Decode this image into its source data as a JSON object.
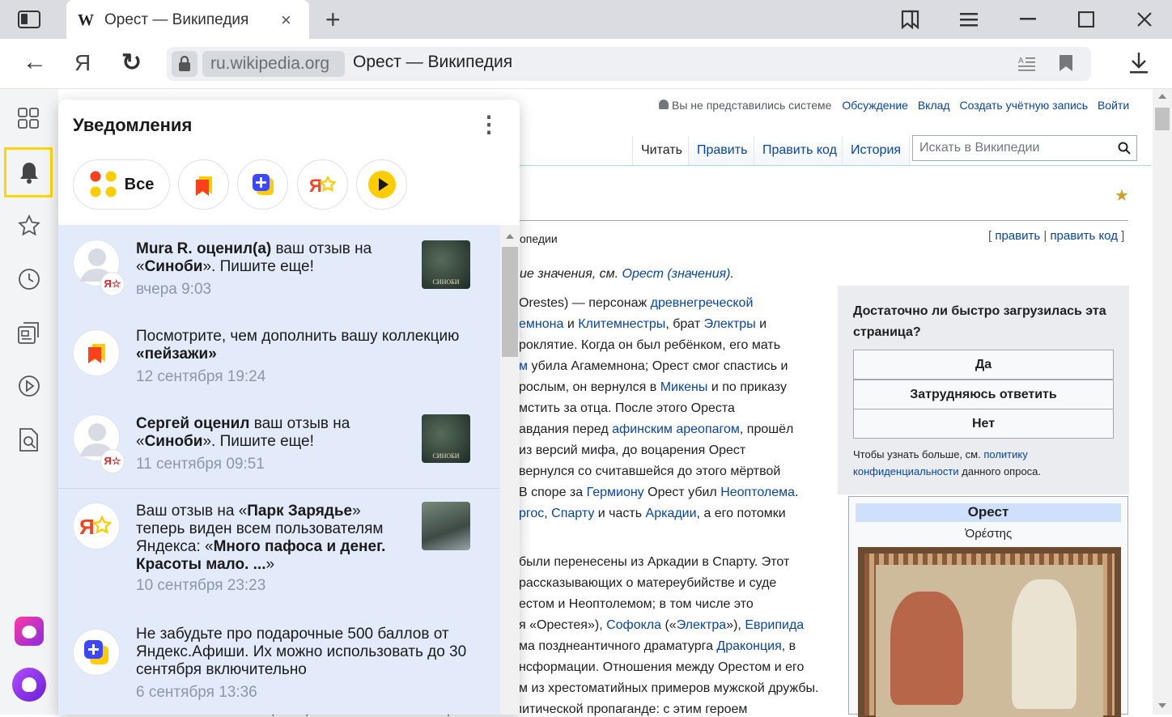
{
  "tab": {
    "favicon": "W",
    "title": "Орест — Википедия",
    "close": "×",
    "new_tab": "+"
  },
  "nav": {
    "back": "←",
    "yandex": "Я",
    "reload": "↻",
    "domain": "ru.wikipedia.org",
    "page_title": "Орест — Википедия"
  },
  "wiki": {
    "user_links": {
      "not_logged": "Вы не представились системе",
      "discussion": "Обсуждение",
      "contribution": "Вклад",
      "create_account": "Создать учётную запись",
      "login": "Войти"
    },
    "tabs": [
      "Читать",
      "Править",
      "Править код",
      "История"
    ],
    "search_placeholder": "Искать в Википедии",
    "edit_links": {
      "open": "[",
      "edit": "править",
      "sep": "|",
      "edit_code": "править код",
      "close": "]"
    },
    "from_text": "опедии",
    "hatnote": {
      "prefix": "ие значения, см.",
      "link": "Орест (значения)",
      "suffix": "."
    },
    "poll": {
      "question": "Достаточно ли быстро загрузилась эта страница?",
      "options": [
        "Да",
        "Затрудняюсь ответить",
        "Нет"
      ],
      "note_prefix": "Чтобы узнать больше, см.",
      "note_link": "политику конфиденциальности",
      "note_suffix": "данного опроса."
    },
    "infobox": {
      "title": "Орест",
      "subtitle": "Ὀρέστης"
    },
    "lines": [
      [
        {
          "t": "Orestes) — персонаж "
        },
        {
          "t": "древнегреческой",
          "l": 1
        }
      ],
      [
        {
          "t": "емнона",
          "l": 1
        },
        {
          "t": " и "
        },
        {
          "t": "Клитемнестры",
          "l": 1
        },
        {
          "t": ", брат "
        },
        {
          "t": "Электры",
          "l": 1
        },
        {
          "t": " и"
        }
      ],
      [
        {
          "t": "роклятие. Когда он был ребёнком, его мать"
        }
      ],
      [
        {
          "t": "м",
          "l": 1
        },
        {
          "t": " убила Агамемнона; Орест смог спастись и"
        }
      ],
      [
        {
          "t": "рослым, он вернулся в "
        },
        {
          "t": "Микены",
          "l": 1
        },
        {
          "t": " и по приказу"
        }
      ],
      [
        {
          "t": "мстить за отца. После этого Ореста"
        }
      ],
      [
        {
          "t": "авдания перед "
        },
        {
          "t": "афинским ареопагом",
          "l": 1
        },
        {
          "t": ", прошёл"
        }
      ],
      [
        {
          "t": "из версий мифа, до воцарения Орест"
        }
      ],
      [
        {
          "t": "вернулся со считавшейся до этого мёртвой"
        }
      ],
      [
        {
          "t": "В споре за "
        },
        {
          "t": "Гермиону",
          "l": 1
        },
        {
          "t": " Орест убил "
        },
        {
          "t": "Неоптолема",
          "l": 1
        },
        {
          "t": "."
        }
      ],
      [
        {
          "t": "ргос",
          "l": 1
        },
        {
          "t": ", "
        },
        {
          "t": "Спарту",
          "l": 1
        },
        {
          "t": " и часть "
        },
        {
          "t": "Аркадии",
          "l": 1
        },
        {
          "t": ", а его потомки"
        }
      ],
      [
        {
          "t": "были перенесены из Аркадии в Спарту. Этот"
        }
      ],
      [
        {
          "t": "рассказывающих о матереубийстве и суде"
        }
      ],
      [
        {
          "t": "естом и Неоптолемом; в том числе это"
        }
      ],
      [
        {
          "t": "я «Орестея»), "
        },
        {
          "t": "Софокла",
          "l": 1
        },
        {
          "t": " («"
        },
        {
          "t": "Электра",
          "l": 1
        },
        {
          "t": "»), "
        },
        {
          "t": "Еврипида",
          "l": 1
        }
      ],
      [
        {
          "t": "ма позднеантичного драматурга "
        },
        {
          "t": "Драконция",
          "l": 1
        },
        {
          "t": ", в"
        }
      ],
      [
        {
          "t": "нсформации. Отношения между Орестом и его"
        }
      ],
      [
        {
          "t": "м из хрестоматийных примеров мужской дружбы."
        }
      ],
      [
        {
          "t": "Образ Ореста использовался в римской политической пропаганде: с этим героем"
        }
      ]
    ]
  },
  "notifications": {
    "title": "Уведомления",
    "menu": "⋮",
    "filter_all": "Все",
    "items": [
      {
        "bold": "Mura R. оценил(а)",
        "text": " ваш отзыв на «",
        "bold2": "Синоби",
        "text2": "». Пишите еще!",
        "time": "вчера 9:03",
        "thumb_label": "СИНОБИ"
      },
      {
        "text": "Посмотрите, чем дополнить вашу коллекцию ",
        "bold": "«пейзажи»",
        "time": "12 сентября 19:24"
      },
      {
        "bold": "Сергей оценил",
        "text": " ваш отзыв на «",
        "bold2": "Синоби",
        "text2": "». Пишите еще!",
        "time": "11 сентября 09:51",
        "thumb_label": "СИНОБИ"
      },
      {
        "text": "Ваш отзыв на «",
        "bold": "Парк Зарядье",
        "text2": "» теперь виден всем пользователям Яндекса: «",
        "bold2": "Много пафоса и денег. Красоты мало. ...",
        "text3": "»",
        "time": "10 сентября 23:23"
      },
      {
        "text": "Не забудьте про подарочные 500 баллов от Яндекс.Афиши. Их можно использовать до 30 сентября включительно",
        "time": "6 сентября 13:36"
      }
    ]
  },
  "colors": {
    "accent": "#ffd600",
    "link": "#0645ad",
    "panel_bg": "#e3ebfa",
    "yandex_red": "#fc3f1d",
    "afisha_blue": "#3b48ff"
  }
}
